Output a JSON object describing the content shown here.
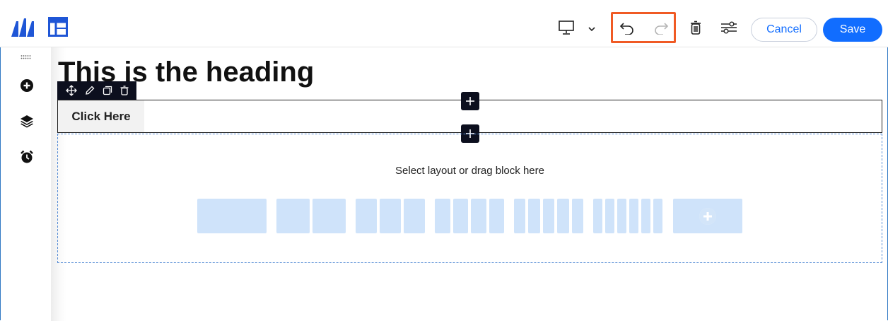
{
  "toolbar": {
    "cancel_label": "Cancel",
    "save_label": "Save",
    "icons": [
      "brand-logo-icon",
      "layout-icon",
      "desktop-icon",
      "chevron-down-icon",
      "undo-icon",
      "redo-icon",
      "trash-icon",
      "settings-sliders-icon"
    ]
  },
  "sidebar": {
    "icons": [
      "drag-grip-icon",
      "add-circle-icon",
      "layers-icon",
      "alarm-clock-icon"
    ]
  },
  "canvas": {
    "heading": "This is the heading",
    "button_label": "Click Here",
    "drop_label": "Select layout or drag block here",
    "layout_options": [
      1,
      2,
      3,
      4,
      5,
      6
    ],
    "element_toolbar_icons": [
      "move-icon",
      "edit-pencil-icon",
      "duplicate-icon",
      "delete-icon"
    ]
  },
  "colors": {
    "accent": "#116dff",
    "highlight": "#f05a24",
    "layout_fill": "#cfe3fa",
    "dark": "#0c0f1e"
  }
}
